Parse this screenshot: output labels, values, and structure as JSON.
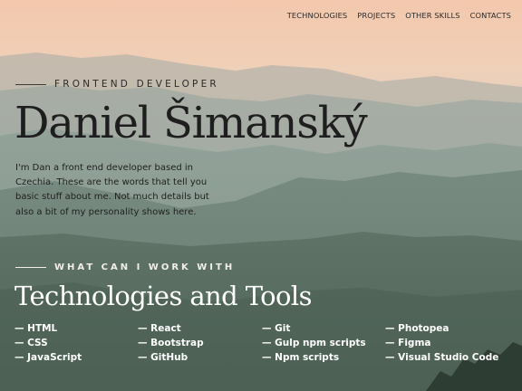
{
  "nav": {
    "items": [
      "TECHNOLOGIES",
      "PROJECTS",
      "OTHER SKILLS",
      "CONTACTS"
    ]
  },
  "hero": {
    "eyebrow": "FRONTEND DEVELOPER",
    "name": "Daniel Šimanský",
    "bio": "I'm Dan a front end developer based in Czechia. These are the words that tell you basic stuff about me. Not much details but also a bit of my personality shows here."
  },
  "technologies": {
    "eyebrow": "WHAT CAN I WORK WITH",
    "title": "Technologies and Tools",
    "columns": [
      [
        "— HTML",
        "— CSS",
        "— JavaScript"
      ],
      [
        "— React",
        "— Bootstrap",
        "— GitHub"
      ],
      [
        "— Git",
        "— Gulp npm scripts",
        "— Npm scripts"
      ],
      [
        "— Photopea",
        "— Figma",
        "— Visual Studio Code"
      ]
    ]
  },
  "colors": {
    "sky_top": "#f3c9ae",
    "mountain_far": "#9aa6a0",
    "mountain_mid": "#7d9188",
    "mountain_near": "#5d7468",
    "text_dark": "#1e1e1e",
    "text_light": "#ffffff"
  }
}
